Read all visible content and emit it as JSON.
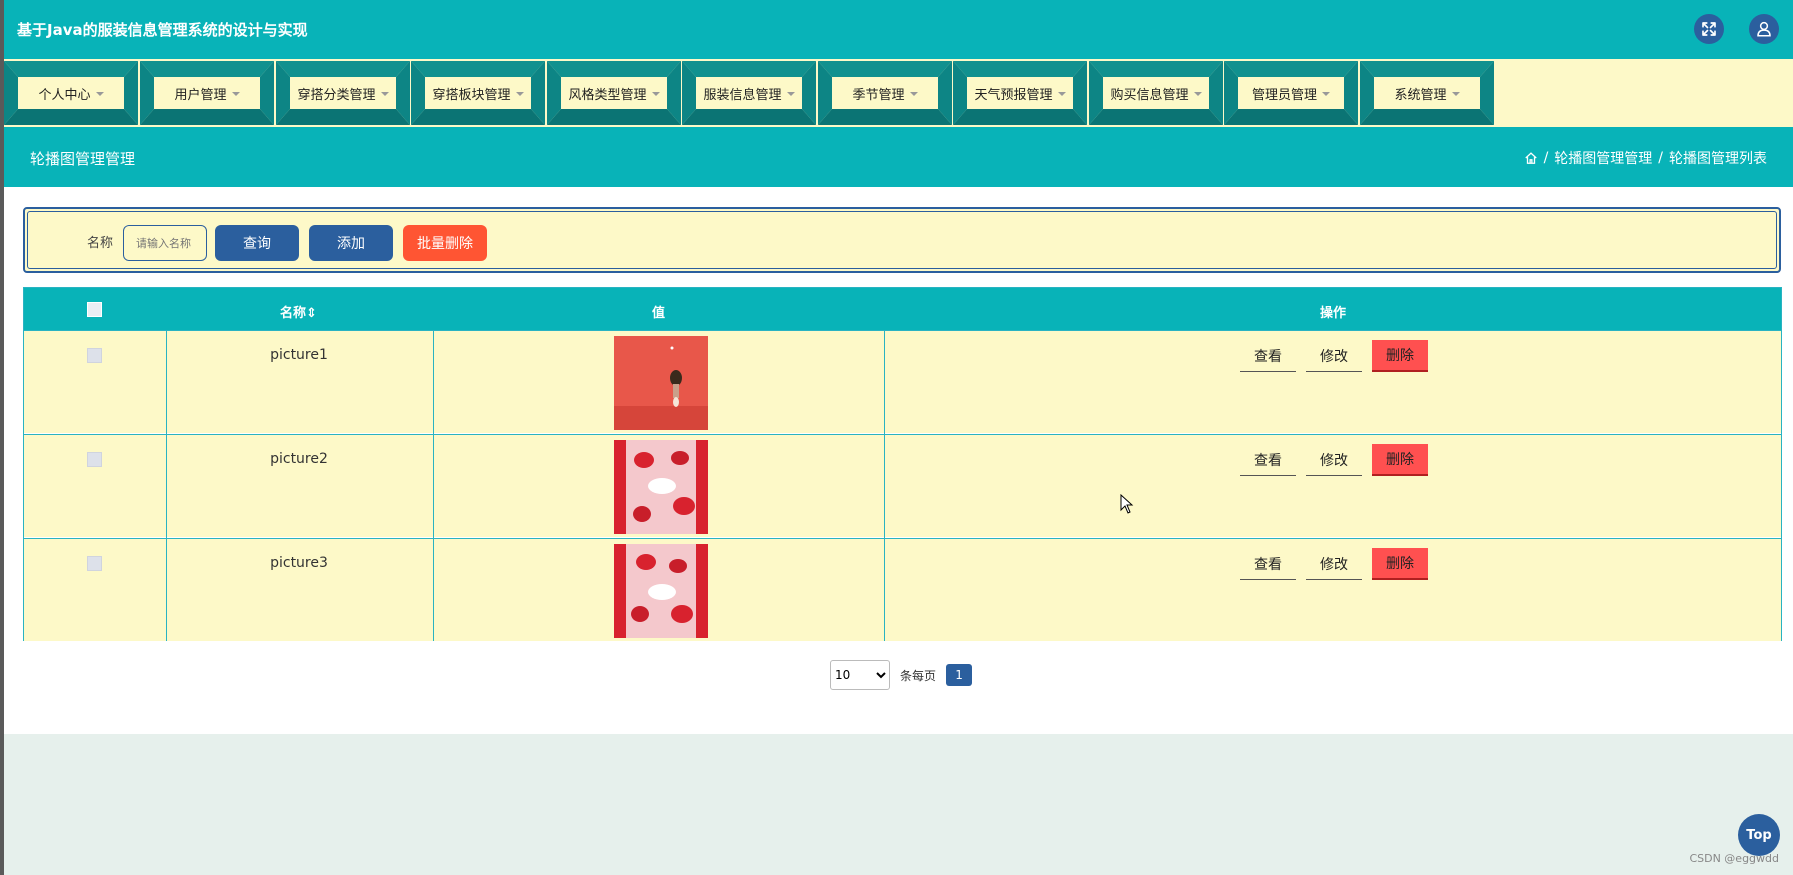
{
  "header": {
    "title": "基于Java的服装信息管理系统的设计与实现"
  },
  "nav": {
    "items": [
      {
        "label": "个人中心"
      },
      {
        "label": "用户管理"
      },
      {
        "label": "穿搭分类管理"
      },
      {
        "label": "穿搭板块管理"
      },
      {
        "label": "风格类型管理"
      },
      {
        "label": "服装信息管理"
      },
      {
        "label": "季节管理"
      },
      {
        "label": "天气预报管理"
      },
      {
        "label": "购买信息管理"
      },
      {
        "label": "管理员管理"
      },
      {
        "label": "系统管理"
      }
    ]
  },
  "crumbbar": {
    "page_title": "轮播图管理管理",
    "crumb1": "轮播图管理管理",
    "crumb2": "轮播图管理列表",
    "sep": "/"
  },
  "search": {
    "label": "名称",
    "placeholder": "请输入名称",
    "query_label": "查询",
    "add_label": "添加",
    "batch_delete_label": "批量删除"
  },
  "table": {
    "headers": {
      "name": "名称",
      "value": "值",
      "ops": "操作"
    },
    "rows": [
      {
        "name": "picture1",
        "view": "查看",
        "edit": "修改",
        "delete": "删除"
      },
      {
        "name": "picture2",
        "view": "查看",
        "edit": "修改",
        "delete": "删除"
      },
      {
        "name": "picture3",
        "view": "查看",
        "edit": "修改",
        "delete": "删除"
      }
    ]
  },
  "pager": {
    "page_size": "10",
    "per_page_label": "条每页",
    "current_page": "1"
  },
  "top_button": "Top",
  "watermark": "CSDN @eggwdd",
  "colors": {
    "teal": "#08b3b8",
    "navy": "#2b5f9e",
    "cream": "#fdf9c8",
    "red": "#ff5533"
  }
}
